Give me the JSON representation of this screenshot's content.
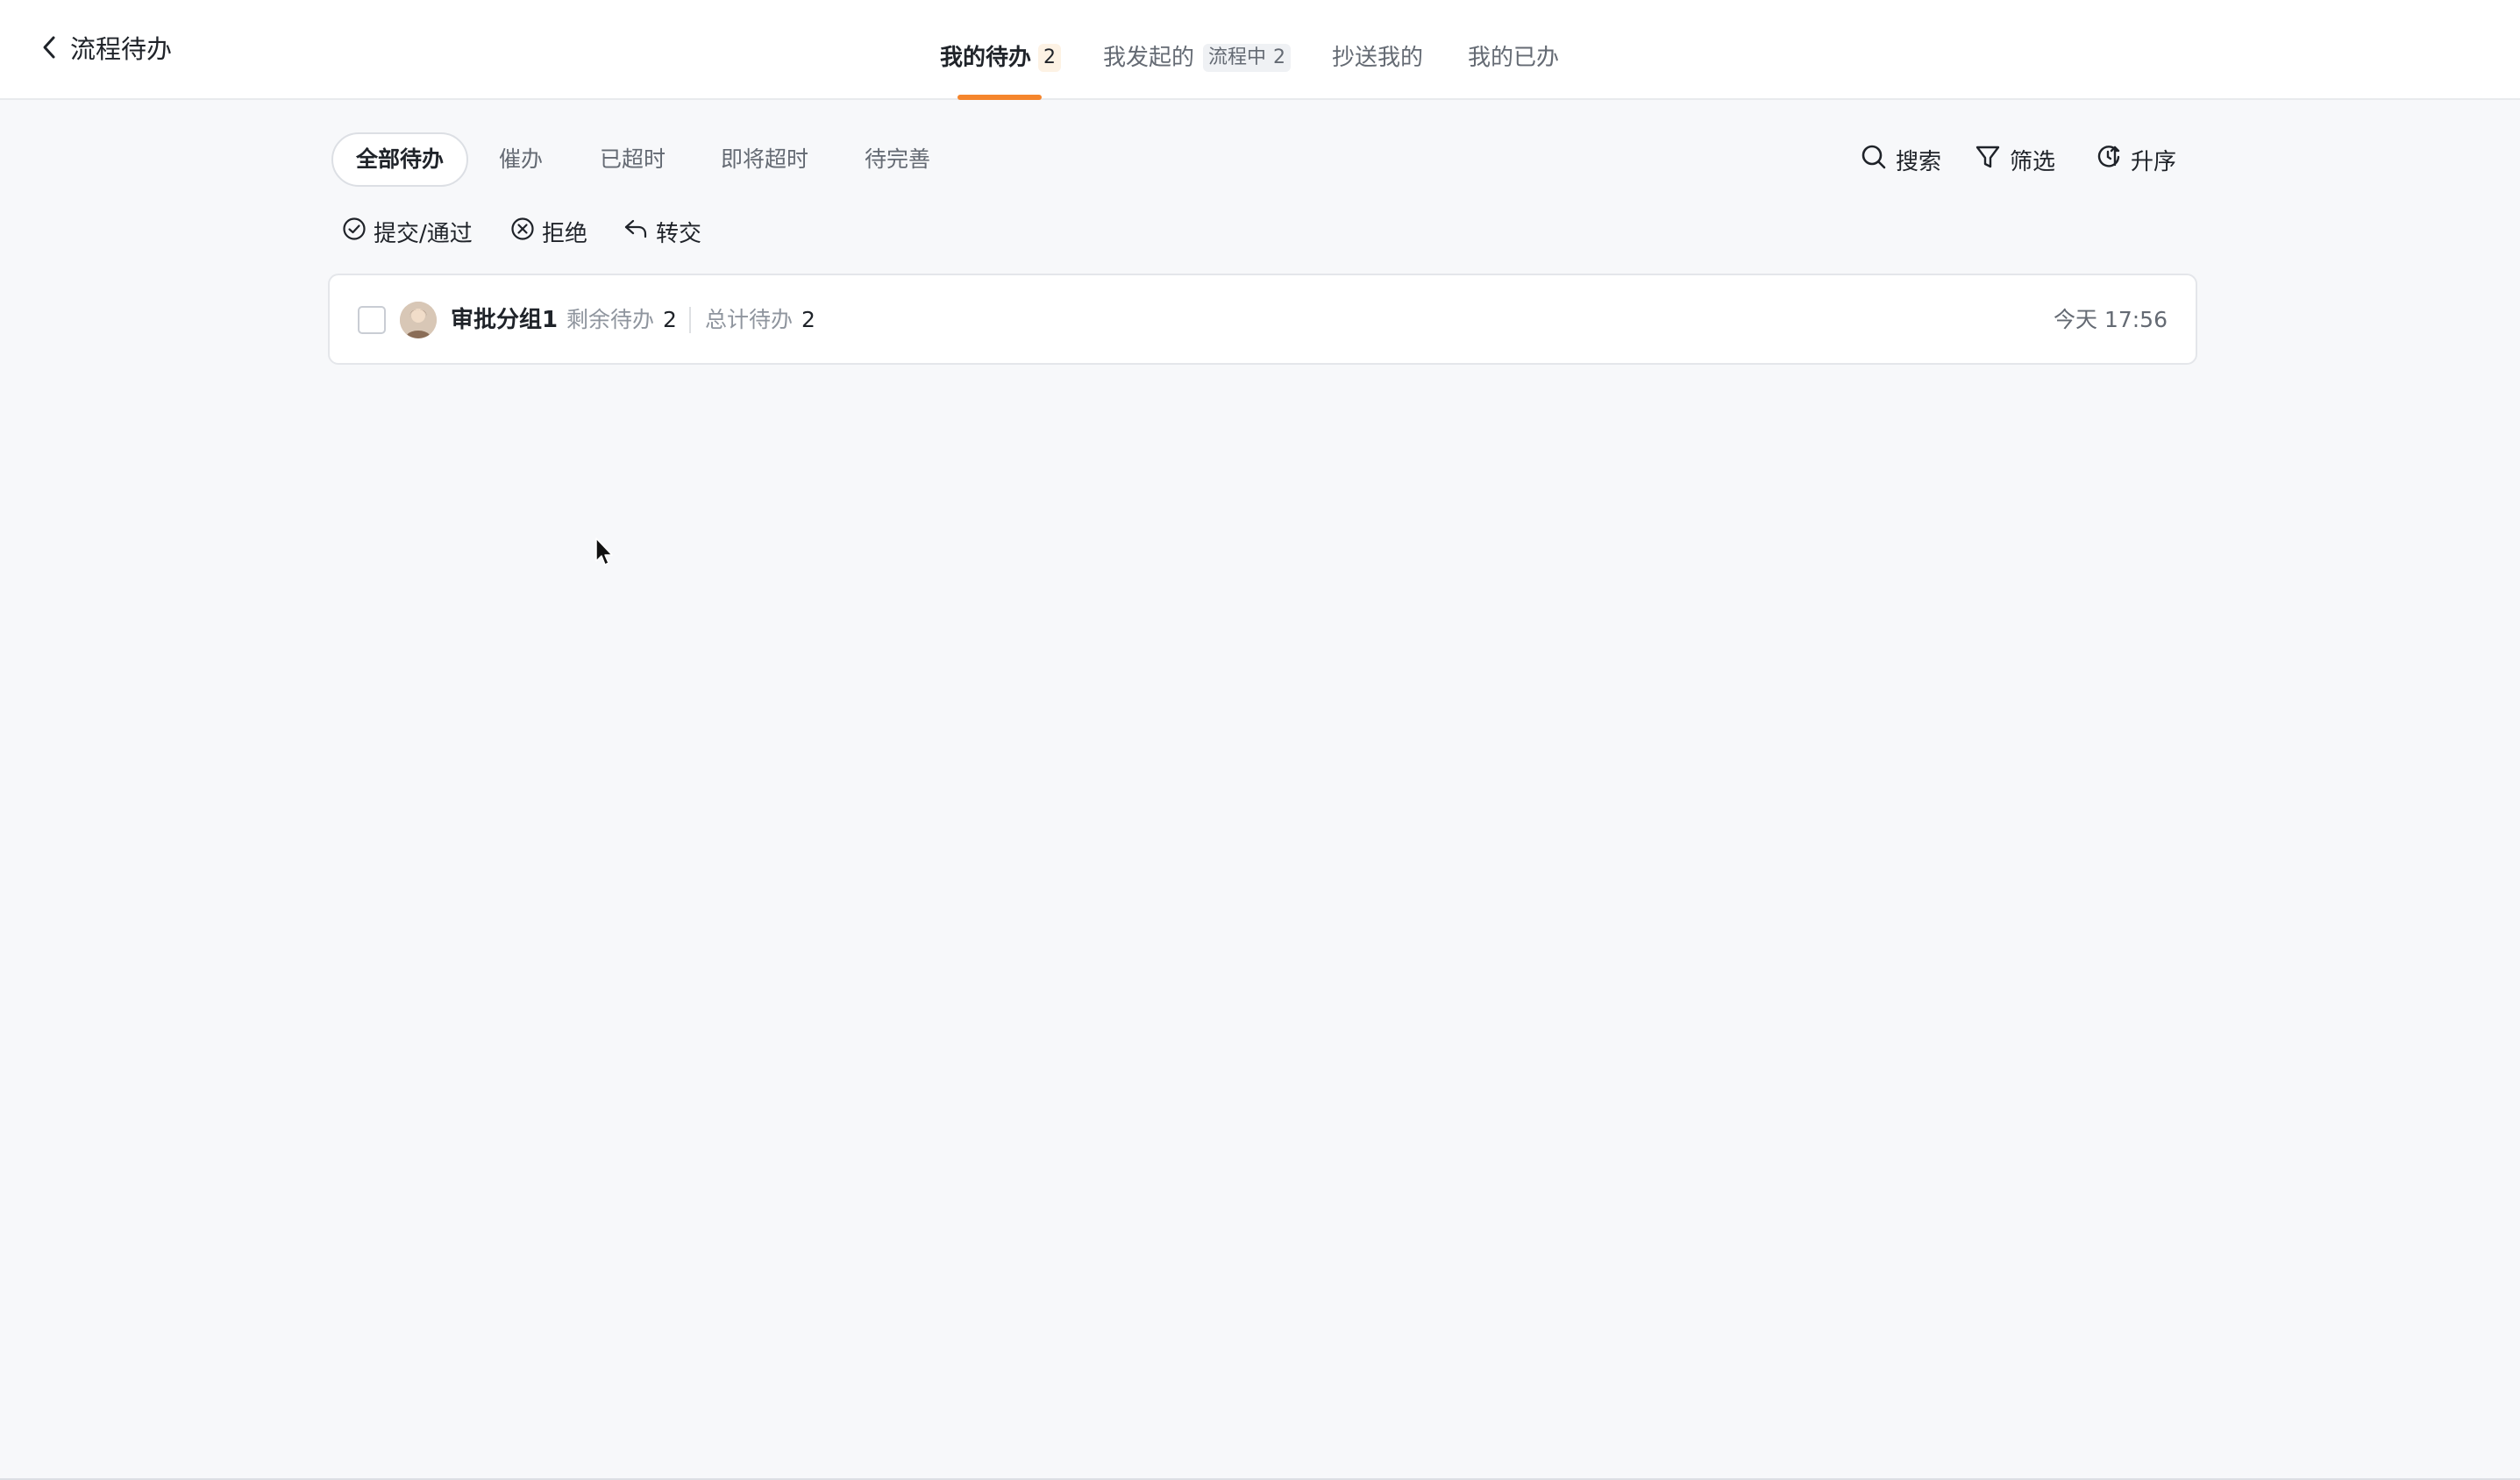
{
  "header": {
    "title": "流程待办",
    "back_icon": "chevron-left-icon"
  },
  "tabs": [
    {
      "label": "我的待办",
      "badge": "2",
      "active": true
    },
    {
      "label": "我发起的",
      "status": "流程中",
      "badge": "2",
      "active": false
    },
    {
      "label": "抄送我的",
      "active": false
    },
    {
      "label": "我的已办",
      "active": false
    }
  ],
  "filters": {
    "chips": [
      "全部待办",
      "催办",
      "已超时",
      "即将超时",
      "待完善"
    ],
    "selected": "全部待办",
    "tools": {
      "search": "搜索",
      "filter": "筛选",
      "sort": "升序"
    }
  },
  "actions": {
    "approve": "提交/通过",
    "reject": "拒绝",
    "transfer": "转交"
  },
  "list": {
    "items": [
      {
        "group": "审批分组1",
        "remaining_label": "剩余待办",
        "remaining": "2",
        "total_label": "总计待办",
        "total": "2",
        "time": "今天 17:56"
      }
    ]
  },
  "colors": {
    "accent": "#f5852c",
    "badge_bg": "#fdf2e4",
    "background": "#f7f8fa"
  }
}
